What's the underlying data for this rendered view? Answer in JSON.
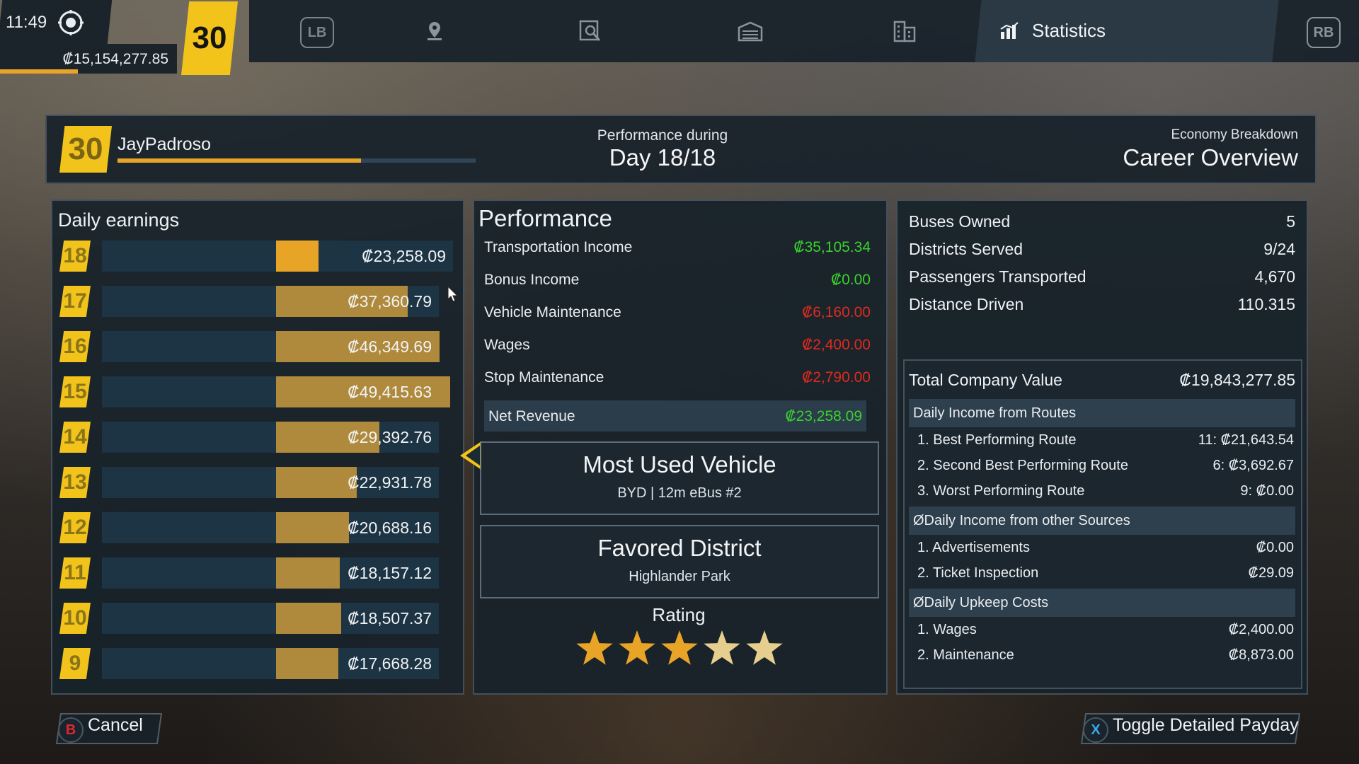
{
  "hud": {
    "time": "11:49",
    "money": "₡15,154,277.85",
    "money_progress": 0.44,
    "level": "30"
  },
  "nav": {
    "lb": "LB",
    "rb": "RB",
    "icons": [
      "map-pin-icon",
      "search-document-icon",
      "depot-icon",
      "buildings-icon"
    ],
    "active_tab": "Statistics"
  },
  "header": {
    "level": "30",
    "player_name": "JayPadroso",
    "xp_progress": 0.68,
    "perf_label": "Performance during",
    "day": "Day 18/18",
    "econ_label": "Economy Breakdown",
    "career_label": "Career Overview"
  },
  "earnings": {
    "title": "Daily earnings",
    "rows": [
      {
        "day": "18",
        "value": "₡23,258.09",
        "amount": 23258.09,
        "active": true
      },
      {
        "day": "17",
        "value": "₡37,360.79",
        "amount": 37360.79
      },
      {
        "day": "16",
        "value": "₡46,349.69",
        "amount": 46349.69
      },
      {
        "day": "15",
        "value": "₡49,415.63",
        "amount": 49415.63
      },
      {
        "day": "14",
        "value": "₡29,392.76",
        "amount": 29392.76
      },
      {
        "day": "13",
        "value": "₡22,931.78",
        "amount": 22931.78
      },
      {
        "day": "12",
        "value": "₡20,688.16",
        "amount": 20688.16
      },
      {
        "day": "11",
        "value": "₡18,157.12",
        "amount": 18157.12
      },
      {
        "day": "10",
        "value": "₡18,507.37",
        "amount": 18507.37
      },
      {
        "day": "9",
        "value": "₡17,668.28",
        "amount": 17668.28
      }
    ]
  },
  "performance": {
    "title": "Performance",
    "items": [
      {
        "label": "Transportation Income",
        "value": "₡35,105.34",
        "color": "#3bd12e"
      },
      {
        "label": "Bonus Income",
        "value": "₡0.00",
        "color": "#3bd12e"
      },
      {
        "label": "Vehicle Maintenance",
        "value": "₡6,160.00",
        "color": "#e02a1e"
      },
      {
        "label": "Wages",
        "value": "₡2,400.00",
        "color": "#e02a1e"
      },
      {
        "label": "Stop Maintenance",
        "value": "₡2,790.00",
        "color": "#e02a1e"
      }
    ],
    "net_label": "Net Revenue",
    "net_value": "₡23,258.09",
    "most_used_title": "Most Used Vehicle",
    "most_used_value": "BYD | 12m eBus #2",
    "favored_title": "Favored District",
    "favored_value": "Highlander Park",
    "rating_label": "Rating",
    "rating": 3,
    "rating_max": 5
  },
  "stats": {
    "top": [
      {
        "label": "Buses Owned",
        "value": "5"
      },
      {
        "label": "Districts Served",
        "value": "9/24"
      },
      {
        "label": "Passengers Transported",
        "value": "4,670"
      },
      {
        "label": "Distance Driven",
        "value": "110.315"
      }
    ],
    "total_label": "Total Company Value",
    "total_value": "₡19,843,277.85",
    "sections": [
      {
        "title": "Daily Income from Routes",
        "lines": [
          {
            "label": "1. Best Performing Route",
            "value": "11: ₡21,643.54"
          },
          {
            "label": "2. Second Best Performing Route",
            "value": "6: ₡3,692.67"
          },
          {
            "label": "3. Worst Performing Route",
            "value": "9: ₡0.00"
          }
        ]
      },
      {
        "title": "ØDaily Income from other Sources",
        "lines": [
          {
            "label": "1. Advertisements",
            "value": "₡0.00"
          },
          {
            "label": "2. Ticket Inspection",
            "value": "₡29.09"
          }
        ]
      },
      {
        "title": "ØDaily Upkeep Costs",
        "lines": [
          {
            "label": "1. Wages",
            "value": "₡2,400.00"
          },
          {
            "label": "2. Maintenance",
            "value": "₡8,873.00"
          }
        ]
      }
    ]
  },
  "footer": {
    "cancel_glyph": "B",
    "cancel_label": "Cancel",
    "toggle_glyph": "X",
    "toggle_label": "Toggle Detailed Payday"
  },
  "colors": {
    "accent": "#f2c31b",
    "bar_active": "#e8a427",
    "bar": "#b08a3c",
    "positive": "#3bd12e",
    "negative": "#e02a1e"
  }
}
